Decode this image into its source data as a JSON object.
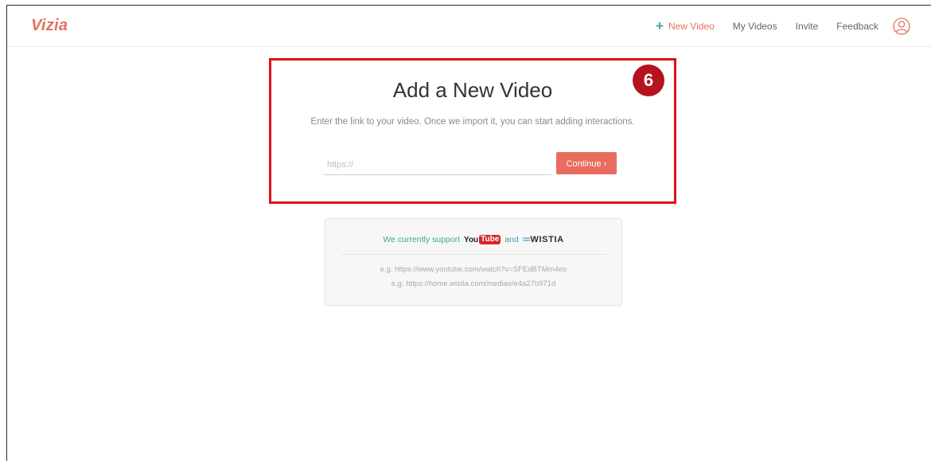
{
  "navbar": {
    "logo": "Vizia",
    "new_video_label": "New Video",
    "my_videos_label": "My Videos",
    "invite_label": "Invite",
    "feedback_label": "Feedback"
  },
  "step_badge": "6",
  "add_video": {
    "title": "Add a New Video",
    "subtitle": "Enter the link to your video. Once we import it, you can start adding interactions.",
    "url_placeholder": "https://",
    "url_value": "",
    "continue_label": "Continue ›"
  },
  "support": {
    "prefix": "We currently support",
    "youtube_you": "You",
    "youtube_tube": "Tube",
    "and_word": "and",
    "wistia_name": "WISTIA",
    "examples": [
      "e.g. https://www.youtube.com/watch?v=SFEdBTMm4eo",
      "e.g. https://home.wistia.com/medias/e4a27b971d"
    ]
  },
  "colors": {
    "brand": "#e56f5d",
    "accent": "#3aa79a",
    "highlight": "#e0101a",
    "badge": "#b5141e"
  }
}
